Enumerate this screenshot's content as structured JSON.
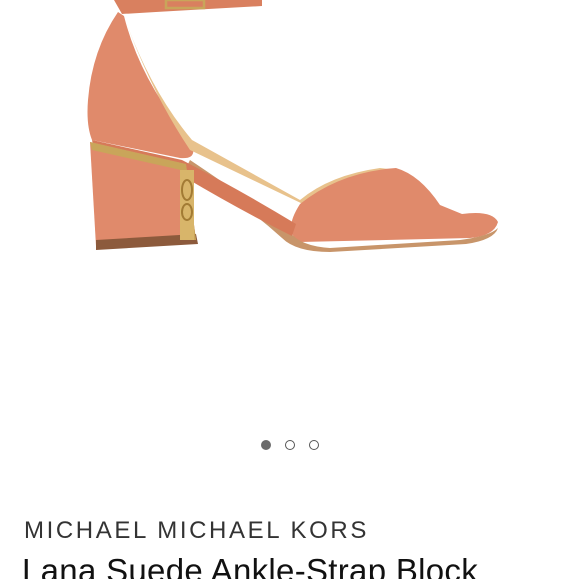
{
  "product": {
    "image_icon": "sandal-image",
    "brand": "MICHAEL MICHAEL KORS",
    "title": "Lana Suede Ankle-Strap Block"
  },
  "carousel": {
    "dot_count": 3,
    "active_index": 0
  },
  "colors": {
    "suede": "#e08a6b",
    "gold": "#c9a55a"
  }
}
